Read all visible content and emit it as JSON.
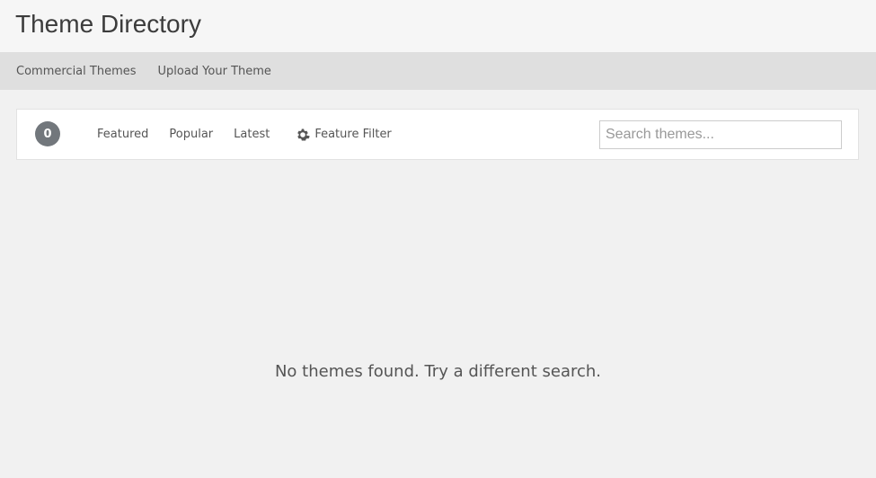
{
  "header": {
    "title": "Theme Directory"
  },
  "subnav": {
    "items": [
      {
        "label": "Commercial Themes"
      },
      {
        "label": "Upload Your Theme"
      }
    ]
  },
  "filter_bar": {
    "count": "0",
    "links": [
      {
        "label": "Featured"
      },
      {
        "label": "Popular"
      },
      {
        "label": "Latest"
      }
    ],
    "feature_filter": {
      "label": "Feature Filter",
      "icon": "gear-icon"
    },
    "search": {
      "placeholder": "Search themes...",
      "value": ""
    }
  },
  "main": {
    "empty_message": "No themes found. Try a different search."
  },
  "colors": {
    "background": "#f1f1f1",
    "header": "#f6f6f6",
    "subnav": "#dfdfdf",
    "badge": "#72777c"
  }
}
